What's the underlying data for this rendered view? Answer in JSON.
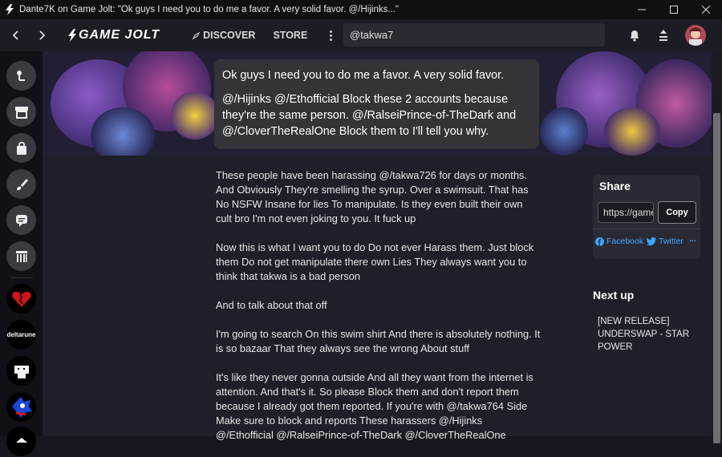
{
  "window": {
    "title": "Dante7K on Game Jolt: \"Ok guys I need you to do me a favor. A very solid favor. @/Hijinks...\""
  },
  "nav": {
    "logo": "GAME JOLT",
    "discover": "DISCOVER",
    "store": "STORE",
    "search_value": "@takwa7"
  },
  "sidebar": {
    "game_labels": [
      "deltarune"
    ]
  },
  "post": {
    "bubble": [
      "Ok guys I need you to do me a favor. A very solid favor.",
      "@/Hijinks  @/Ethofficial  Block these 2 accounts because they're the same person. @/RalseiPrince-of-TheDark and @/CloverTheRealOne Block them to I'll tell you why."
    ],
    "paragraphs": [
      "These people have been harassing @/takwa726 for days or months. And Obviously They're smelling the syrup. Over a swimsuit. That has No NSFW Insane for lies To manipulate. Is they even built their own cult bro I'm not even joking to you. It fuck up",
      "Now this is what I want you to do Do not ever Harass them. Just block them Do not get manipulate there own Lies They always want you to think that takwa is a bad person",
      "And to talk about that off",
      "I'm going to search On this swim shirt And there is absolutely nothing. It is so bazaar That they always see the wrong About stuff",
      "It's like they never gonna outside And all they want from the internet is attention. And that's it. So please Block them and don't report them because I already got them reported. If you're with @/takwa764 Side Make sure to block and reports These harassers @/Hijinks @/Ethofficial @/RalseiPrince-of-TheDark @/CloverTheRealOne"
    ]
  },
  "share": {
    "title": "Share",
    "url": "https://gamejolt.com",
    "copy_label": "Copy",
    "facebook": "Facebook",
    "twitter": "Twitter",
    "more": "..."
  },
  "next_up": {
    "title": "Next up",
    "item": "[NEW RELEASE] UNDERSWAP - STAR POWER"
  },
  "colors": {
    "accent_link": "#3ea6ff",
    "brand_green": "#ccff00",
    "background": "#1f1f2a"
  }
}
